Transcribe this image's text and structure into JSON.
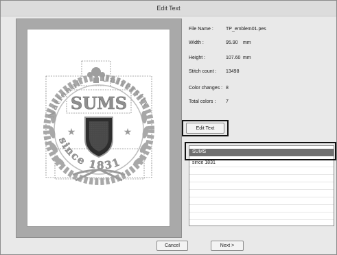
{
  "window": {
    "title": "Edit Text"
  },
  "info": {
    "file_name_label": "File Name :",
    "file_name_value": "TP_emblem01.pes",
    "width_label": "Width :",
    "width_value": "95.90",
    "width_unit": "mm",
    "height_label": "Height :",
    "height_value": "107.60",
    "height_unit": "mm",
    "stitch_count_label": "Stitch count :",
    "stitch_count_value": "13498",
    "color_changes_label": "Color changes :",
    "color_changes_value": "8",
    "total_colors_label": "Total colors :",
    "total_colors_value": "7"
  },
  "buttons": {
    "edit_text": "Edit Text",
    "cancel": "Cancel",
    "next": "Next >"
  },
  "text_list": {
    "items": [
      "SUMS",
      "since 1831"
    ],
    "selected_index": 0
  },
  "emblem": {
    "main_text": "SUMS",
    "arc_top_left": "National",
    "arc_top_right": "University",
    "arc_bottom": "since 1831"
  }
}
